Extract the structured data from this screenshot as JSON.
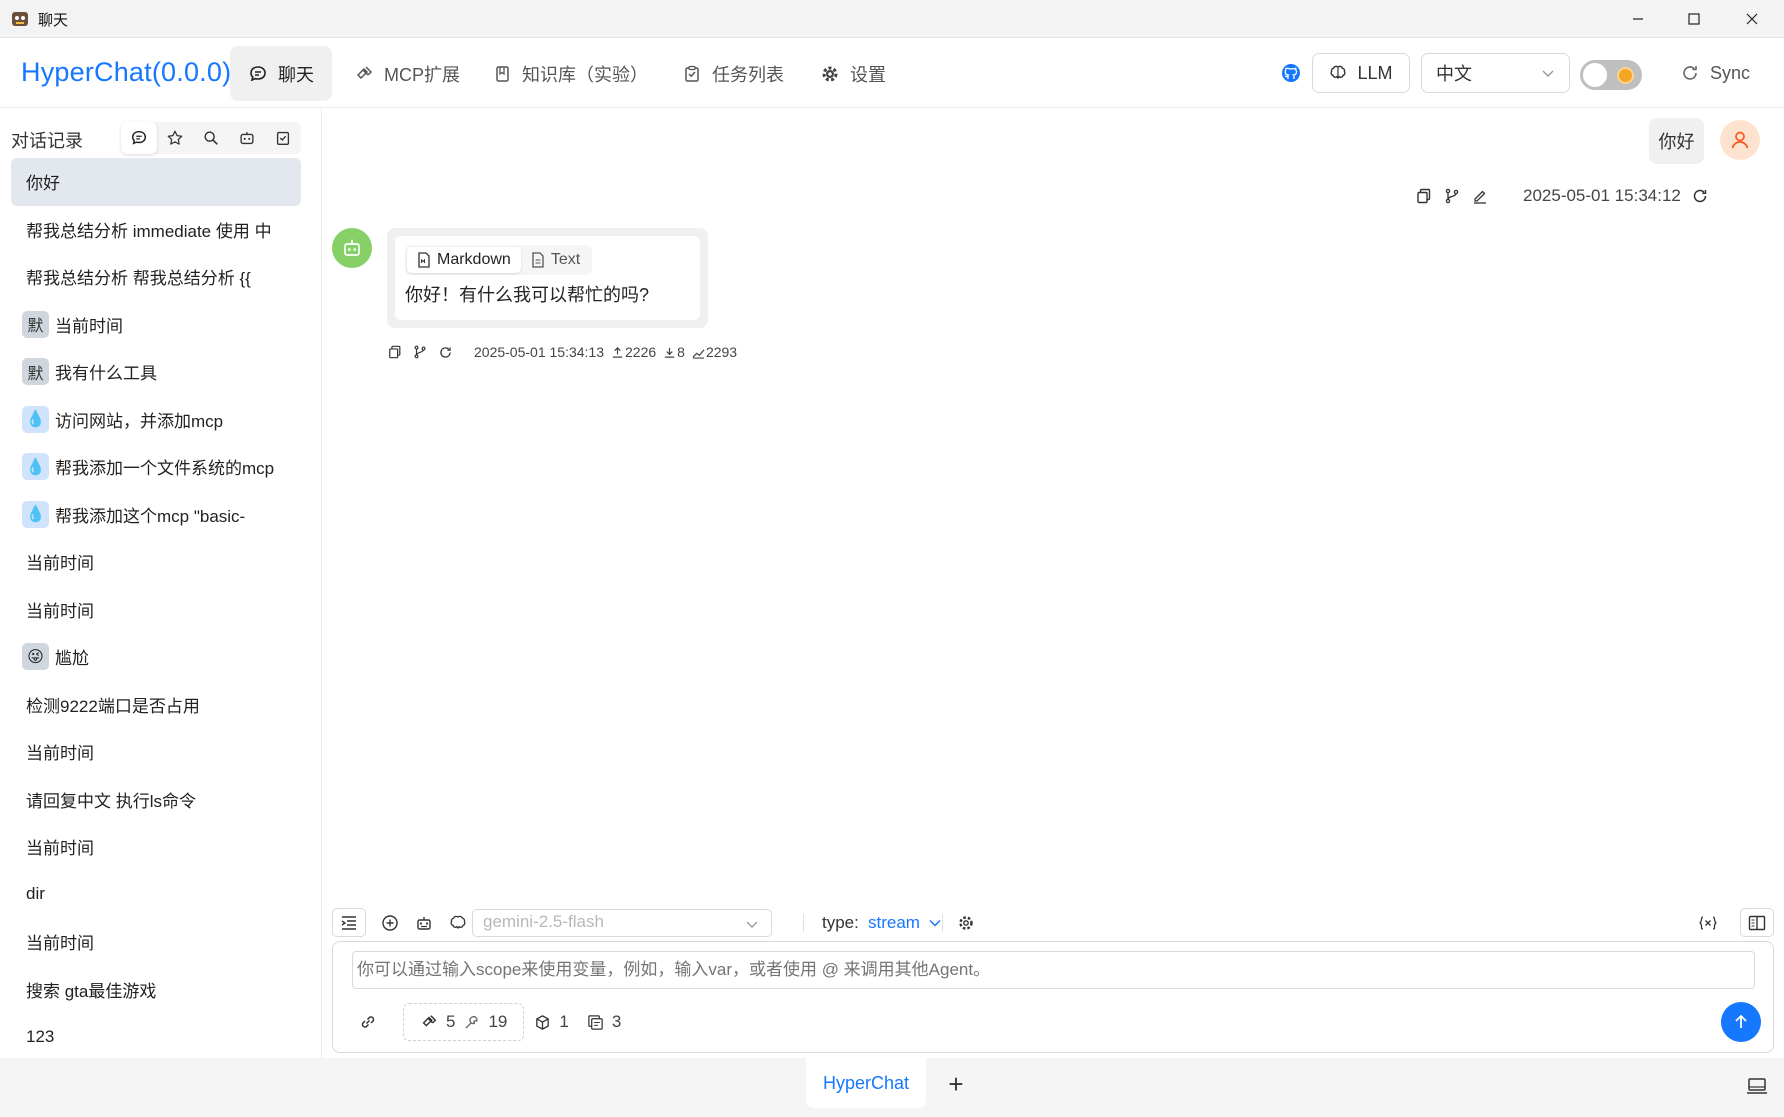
{
  "window": {
    "title": "聊天"
  },
  "header": {
    "brand": "HyperChat(0.0.0)",
    "tabs": [
      {
        "label": "聊天",
        "icon": "chat-icon",
        "active": true
      },
      {
        "label": "MCP扩展",
        "icon": "plugin-icon"
      },
      {
        "label": "知识库（实验）",
        "icon": "book-icon"
      },
      {
        "label": "任务列表",
        "icon": "task-icon"
      },
      {
        "label": "设置",
        "icon": "gear-icon"
      }
    ],
    "llm_label": "LLM",
    "language": "中文",
    "sync_label": "Sync"
  },
  "sidebar": {
    "title": "对话记录",
    "items": [
      {
        "label": "你好",
        "active": true
      },
      {
        "label": "帮我总结分析 immediate 使用 中"
      },
      {
        "label": "帮我总结分析 帮我总结分析 {{"
      },
      {
        "avatar": "默",
        "label": "当前时间"
      },
      {
        "avatar": "默",
        "label": "我有什么工具"
      },
      {
        "avatar": "💧",
        "label": "访问网站，并添加mcp"
      },
      {
        "avatar": "💧",
        "label": "帮我添加一个文件系统的mcp"
      },
      {
        "avatar": "💧",
        "label": "帮我添加这个mcp \"basic-"
      },
      {
        "label": "当前时间"
      },
      {
        "label": "当前时间"
      },
      {
        "avatar": "😜",
        "label": "尴尬"
      },
      {
        "label": "检测9222端口是否占用"
      },
      {
        "label": "当前时间"
      },
      {
        "label": "请回复中文 执行ls命令"
      },
      {
        "label": "当前时间"
      },
      {
        "label": "dir"
      },
      {
        "label": "当前时间"
      },
      {
        "label": "搜索 gta最佳游戏"
      },
      {
        "label": "123"
      }
    ]
  },
  "chat": {
    "user_message": "你好",
    "user_time": "2025-05-01 15:34:12",
    "bot": {
      "view_options": [
        "Markdown",
        "Text"
      ],
      "message": "你好！有什么我可以帮忙的吗?",
      "time": "2025-05-01 15:34:13",
      "stat_input": "2226",
      "stat_output": "8",
      "stat_total": "2293"
    }
  },
  "composer": {
    "model_placeholder": "gemini-2.5-flash",
    "type_label": "type:",
    "type_value": "stream",
    "input_placeholder": "你可以通过输入scope来使用变量，例如，输入var，或者使用 @ 来调用其他Agent。",
    "mcp_count": "5",
    "tool_count": "19",
    "resource_count": "1",
    "prompt_count": "3"
  },
  "bottombar": {
    "tab": "HyperChat",
    "add": "+"
  },
  "colors": {
    "accent": "#1677ff",
    "bot_avatar": "#87d068",
    "user_avatar": "#fde3cf"
  }
}
